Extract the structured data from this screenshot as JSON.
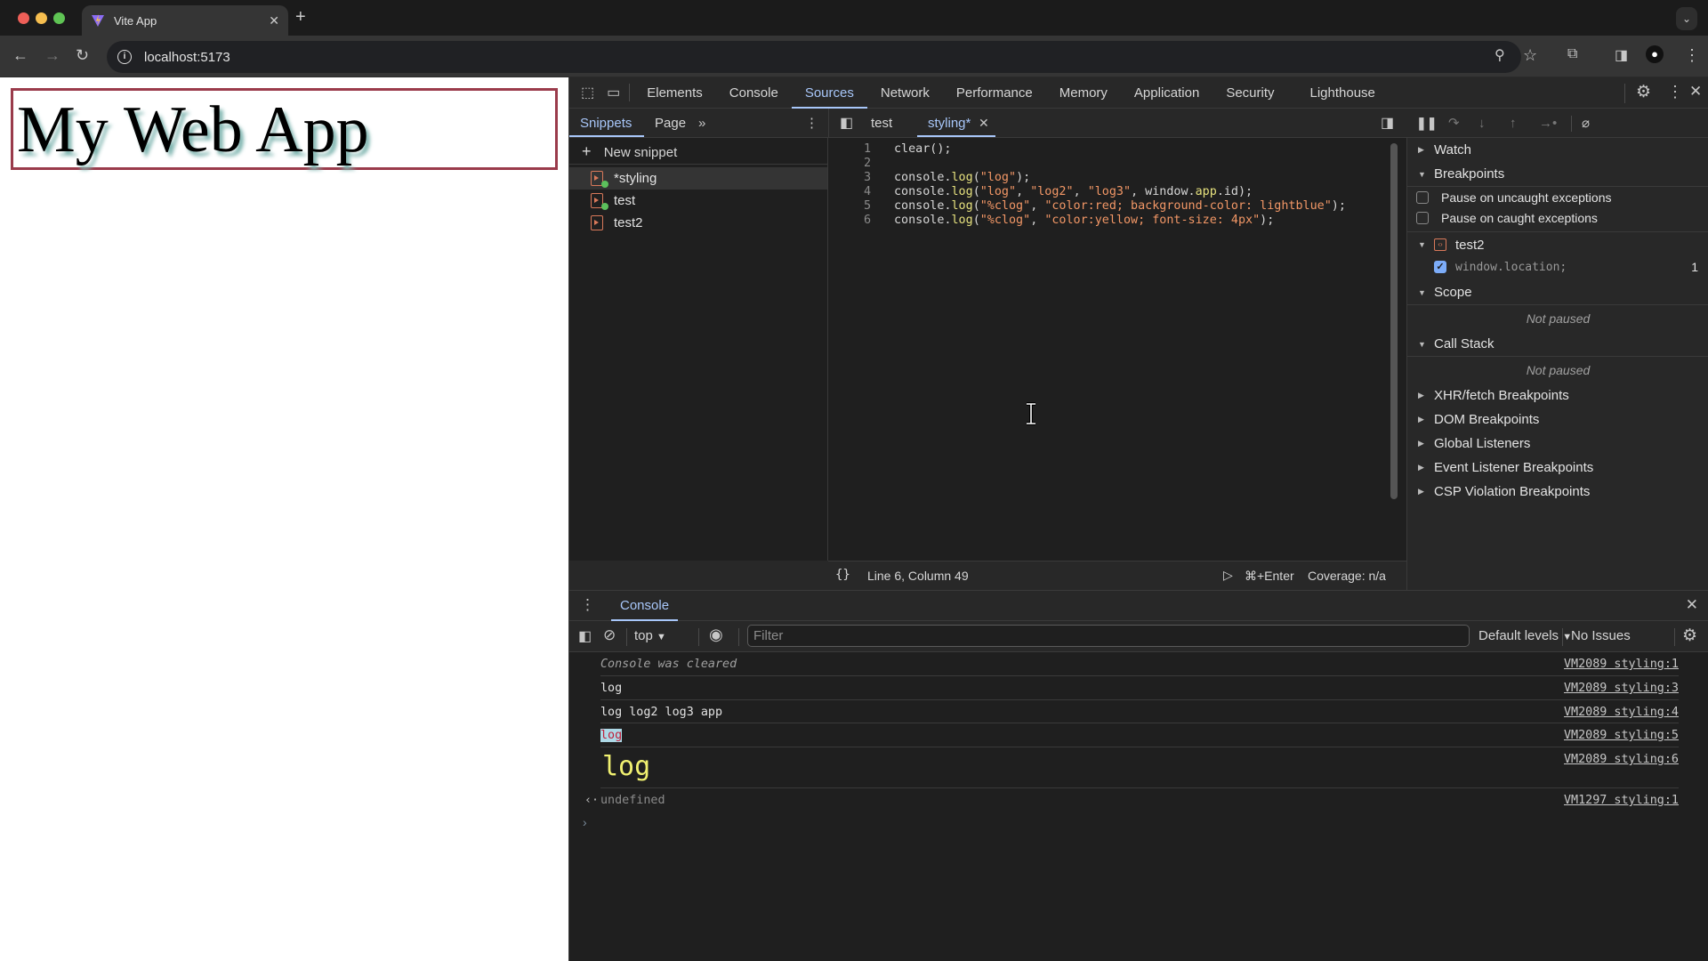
{
  "browser": {
    "tab_title": "Vite App",
    "url": "localhost:5173",
    "traffic_colors": {
      "close": "#ee5f58",
      "minimize": "#f6be4f",
      "maximize": "#5fc454"
    }
  },
  "page": {
    "heading": "My Web App",
    "border_color": "#9a3b4b"
  },
  "devtools": {
    "main_tabs": [
      "Elements",
      "Console",
      "Sources",
      "Network",
      "Performance",
      "Memory",
      "Application",
      "Security",
      "Lighthouse"
    ],
    "active_tab": "Sources",
    "navigator": {
      "tabs": [
        "Snippets",
        "Page"
      ],
      "active_tab": "Snippets",
      "new_snippet_label": "New snippet",
      "snippets": [
        {
          "name": "*styling",
          "selected": true,
          "running": true
        },
        {
          "name": "test",
          "selected": false,
          "running": true
        },
        {
          "name": "test2",
          "selected": false,
          "running": false
        }
      ]
    },
    "editor": {
      "open_files": [
        {
          "name": "test",
          "active": false
        },
        {
          "name": "styling*",
          "active": true
        }
      ],
      "lines": [
        {
          "n": "1",
          "code": "clear();"
        },
        {
          "n": "2",
          "code": ""
        },
        {
          "n": "3",
          "code": "console.log(\"log\");"
        },
        {
          "n": "4",
          "code": "console.log(\"log\", \"log2\", \"log3\", window.app.id);"
        },
        {
          "n": "5",
          "code": "console.log(\"%clog\", \"color:red; background-color: lightblue\");"
        },
        {
          "n": "6",
          "code": "console.log(\"%clog\", \"color:yellow; font-size: 4px\");"
        }
      ],
      "status_position": "Line 6, Column 49",
      "run_shortcut": "⌘+Enter",
      "coverage": "Coverage: n/a"
    },
    "debugger": {
      "watch_label": "Watch",
      "breakpoints_label": "Breakpoints",
      "pause_uncaught": {
        "label": "Pause on uncaught exceptions",
        "checked": false
      },
      "pause_caught": {
        "label": "Pause on caught exceptions",
        "checked": false
      },
      "bp_file": "test2",
      "bp_entry": {
        "code": "window.location;",
        "line": "1",
        "checked": true
      },
      "scope_label": "Scope",
      "scope_status": "Not paused",
      "callstack_label": "Call Stack",
      "callstack_status": "Not paused",
      "collapsed_sections": [
        "XHR/fetch Breakpoints",
        "DOM Breakpoints",
        "Global Listeners",
        "Event Listener Breakpoints",
        "CSP Violation Breakpoints"
      ]
    },
    "drawer": {
      "tab": "Console",
      "context": "top",
      "filter_placeholder": "Filter",
      "levels": "Default levels",
      "issues": "No Issues"
    },
    "console_messages": [
      {
        "text": "Console was cleared",
        "source": "VM2089 styling:1",
        "style": "cleared"
      },
      {
        "text": "log",
        "source": "VM2089 styling:3",
        "style": "plain"
      },
      {
        "text": "log log2 log3 app",
        "source": "VM2089 styling:4",
        "style": "plain"
      },
      {
        "text": "log",
        "source": "VM2089 styling:5",
        "style": "red-on-lightblue"
      },
      {
        "text": "log",
        "source": "VM2089 styling:6",
        "style": "yellow-large"
      },
      {
        "text": "undefined",
        "source": "VM1297 styling:1",
        "style": "result"
      }
    ]
  }
}
